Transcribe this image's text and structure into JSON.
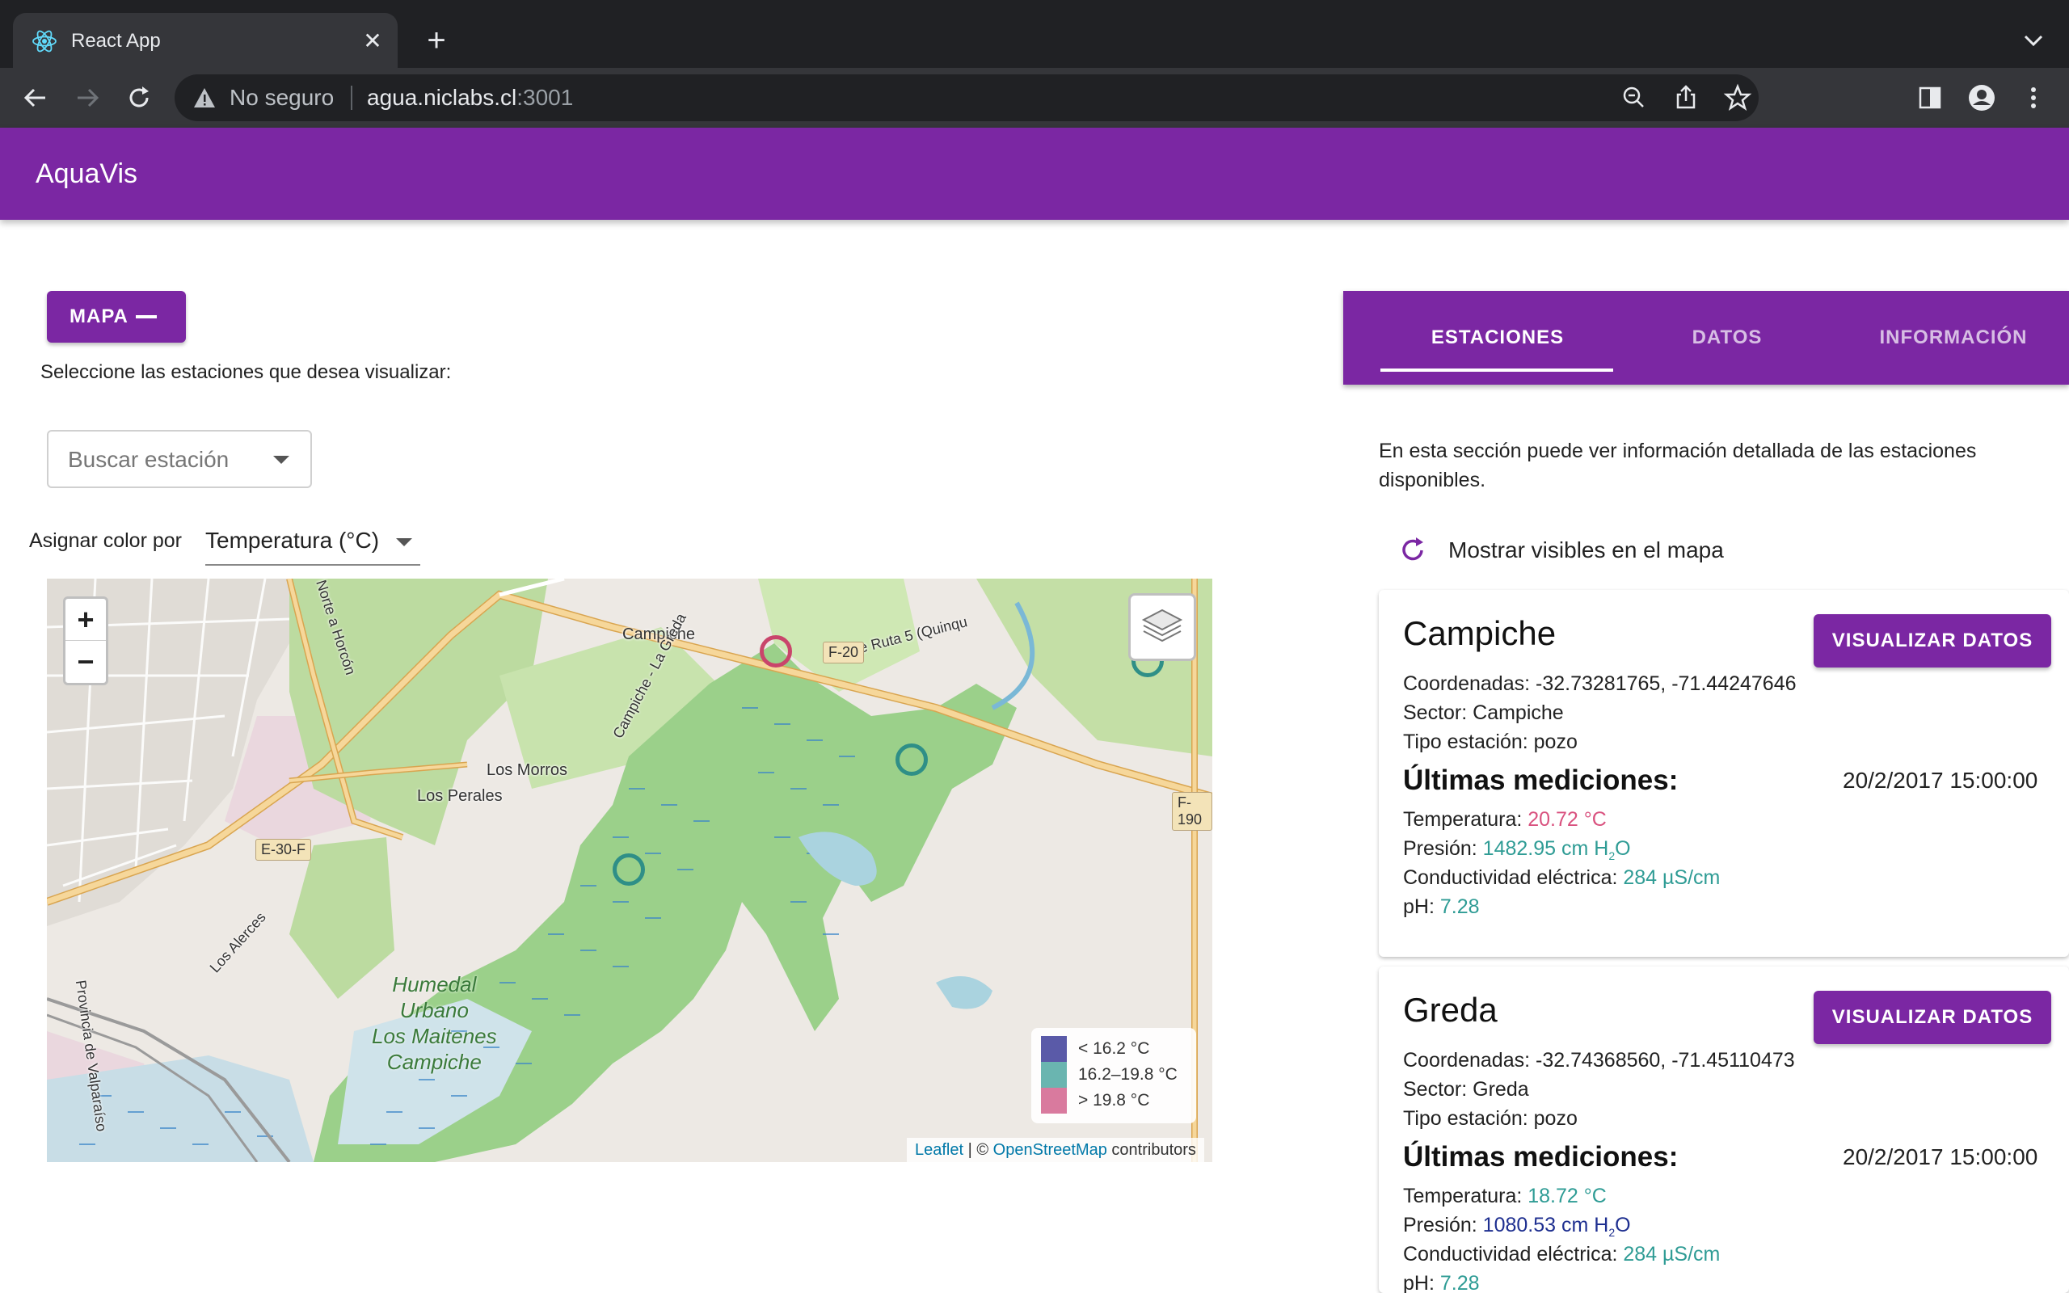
{
  "browser": {
    "tab_title": "React App",
    "security_label": "No seguro",
    "url_host": "agua.niclabs.cl",
    "url_port": ":3001"
  },
  "app": {
    "title": "AquaVis"
  },
  "left_panel": {
    "map_button_label": "MAPA",
    "select_instructions": "Seleccione las estaciones que desea visualizar:",
    "search_placeholder": "Buscar estación",
    "color_by_label": "Asignar color por",
    "color_by_value": "Temperatura (°C)"
  },
  "map": {
    "zoom_in": "+",
    "zoom_out": "−",
    "labels": {
      "campiche": "Campiche",
      "los_morros": "Los Morros",
      "los_perales": "Los Perales",
      "cruce": "Cruce Ruta 5 (Quinqu",
      "campiche_la_greda": "Campiche - La Greda",
      "norte_horcon": "Norte a Horcón",
      "los_alerces": "Los Alerces",
      "provincia": "Provincia de Valparaíso",
      "humedal": [
        "Humedal",
        "Urbano",
        "Los Maitenes",
        "Campiche"
      ]
    },
    "shields": {
      "f20": "F-20",
      "e30f": "E-30-F",
      "f190": "F-190"
    },
    "legend": [
      {
        "label": "< 16.2 °C",
        "color": "#5a5aa8"
      },
      {
        "label": "16.2–19.8 °C",
        "color": "#6ab5b0"
      },
      {
        "label": "> 19.8 °C",
        "color": "#d97a9e"
      }
    ],
    "attribution": {
      "leaflet": "Leaflet",
      "separator": " | © ",
      "osm": "OpenStreetMap",
      "suffix": " contributors"
    }
  },
  "right_panel": {
    "tabs": [
      "ESTACIONES",
      "DATOS",
      "INFORMACIÓN"
    ],
    "description": "En esta sección puede ver información detallada de las estaciones disponibles.",
    "show_visible_label": "Mostrar visibles en el mapa",
    "stations": [
      {
        "name": "Campiche",
        "button": "VISUALIZAR DATOS",
        "coords": "Coordenadas: -32.73281765, -71.44247646",
        "sector": "Sector: Campiche",
        "tipo": "Tipo estación: pozo",
        "heading": "Últimas mediciones:",
        "date": "20/2/2017 15:00:00",
        "temp_label": "Temperatura: ",
        "temp_value": "20.72 °C",
        "pres_label": "Presión: ",
        "pres_value": "1482.95 cm H",
        "pres_sub": "2",
        "pres_suffix": "O",
        "cond_label": "Conductividad eléctrica: ",
        "cond_value": "284 µS/cm",
        "ph_label": "pH: ",
        "ph_value": "7.28"
      },
      {
        "name": "Greda",
        "button": "VISUALIZAR DATOS",
        "coords": "Coordenadas: -32.74368560, -71.45110473",
        "sector": "Sector: Greda",
        "tipo": "Tipo estación: pozo",
        "heading": "Últimas mediciones:",
        "date": "20/2/2017 15:00:00",
        "temp_label": "Temperatura: ",
        "temp_value": "18.72 °C",
        "pres_label": "Presión: ",
        "pres_value": "1080.53 cm H",
        "pres_sub": "2",
        "pres_suffix": "O",
        "cond_label": "Conductividad eléctrica: ",
        "cond_value": "284 µS/cm",
        "ph_label": "pH: ",
        "ph_value": "7.28"
      }
    ]
  },
  "colors": {
    "brand_purple": "#7b27a3",
    "marker_teal": "#2f8f87",
    "marker_red": "#c9456b",
    "wetland_green": "#7fc97f"
  }
}
